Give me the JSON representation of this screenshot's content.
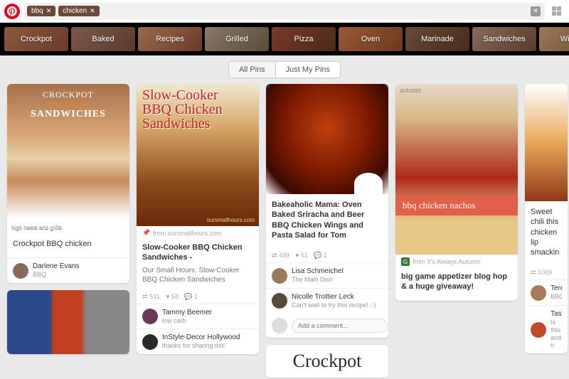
{
  "header": {
    "tags": [
      "bbq",
      "chicken"
    ]
  },
  "categories": [
    "Crockpot",
    "Baked",
    "Recipes",
    "Grilled",
    "Pizza",
    "Oven",
    "Marinade",
    "Sandwiches",
    "Wings"
  ],
  "tabs": {
    "all": "All Pins",
    "mine": "Just My Pins"
  },
  "col1": {
    "pin1": {
      "overlay1": "CROCKPOT",
      "overlay2": "BBQ Chicken",
      "overlay3": "SANDWICHES",
      "caption": "high heels and grills",
      "title": "Crockpot BBQ chicken",
      "user": "Darlene Evans",
      "board": "BBQ"
    }
  },
  "col2": {
    "pin1": {
      "overlay": "Slow-Cooker\nBBQ Chicken\nSandwiches",
      "watermark": "oursmallhours.com",
      "source": "from oursmallhours.com",
      "title": "Slow-Cooker BBQ Chicken Sandwiches -",
      "desc": "Our Small Hours: Slow-Cooker BBQ Chicken Sandwiches",
      "stats_pins": "531",
      "stats_likes": "58",
      "stats_comments": "1",
      "user1": "Tammy Beemer",
      "board1": "low carb",
      "user2": "InStyle-Decor Hollywood",
      "comment2": "thanks for sharing this"
    }
  },
  "col3": {
    "pin1": {
      "title": "Bakeaholic Mama: Oven Baked Sriracha and Beer BBQ Chicken Wings and Pasta Salad for Tom",
      "stats_pins": "499",
      "stats_likes": "51",
      "stats_comments": "1",
      "user1": "Lisa Schmeichel",
      "board1": "The Main Dish",
      "user2": "Nicolle Trottier Leck",
      "comment2": "Can't wait to try this recipe! :-)",
      "comment_ph": "Add a comment..."
    },
    "pin2_script": "Crockpot"
  },
  "col4": {
    "pin1": {
      "src_top": "autumn",
      "banner": "bbq chicken nachos",
      "source": "from It's Always Autumn",
      "title": "big game appetizer blog hop & a huge giveaway!"
    }
  },
  "col5": {
    "pin1": {
      "title": "Sweet chili this chicken lip smackin",
      "user1": "Teres",
      "board1": "BBQS",
      "user2": "Tasty",
      "comment2": "Is this and h"
    }
  }
}
